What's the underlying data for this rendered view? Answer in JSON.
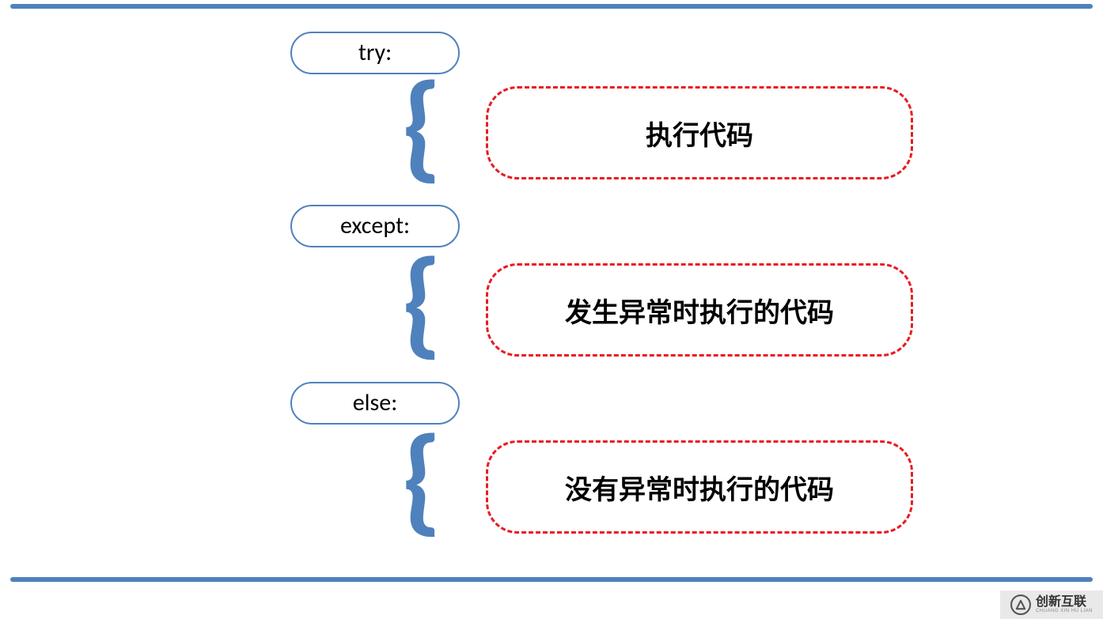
{
  "colors": {
    "blue": "#4f81bd",
    "red": "#e81b23"
  },
  "keywords": {
    "try": "try:",
    "except": "except:",
    "else": "else:"
  },
  "descriptions": {
    "try": "执行代码",
    "except": "发生异常时执行的代码",
    "else": "没有异常时执行的代码"
  },
  "brace_glyph": "{",
  "watermark": {
    "main": "创新互联",
    "sub": "CHUANG XIN HU LIAN"
  }
}
